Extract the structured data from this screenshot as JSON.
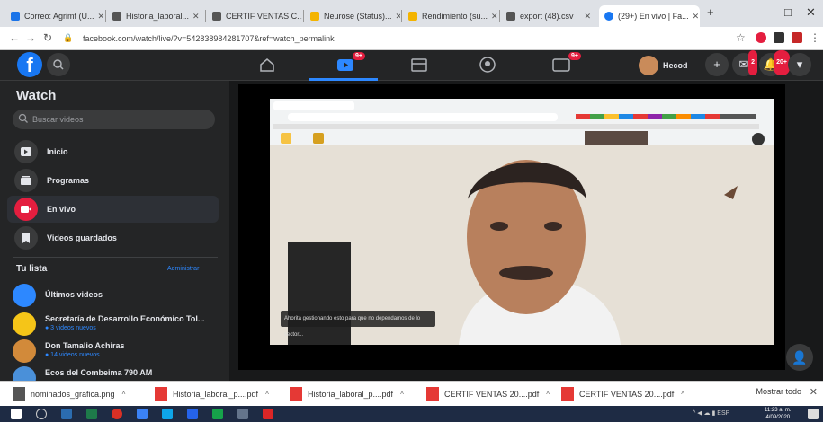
{
  "browser": {
    "tabs": [
      {
        "label": "Correo: Agrimf (U...",
        "color": "#1a73e8"
      },
      {
        "label": "Historia_laboral...",
        "color": "#555555"
      },
      {
        "label": "CERTIF VENTAS C...",
        "color": "#555555"
      },
      {
        "label": "Neurose (Status)...",
        "color": "#f4b400"
      },
      {
        "label": "Rendimiento (su...",
        "color": "#f4b400"
      },
      {
        "label": "export (48).csv",
        "color": "#555555"
      },
      {
        "label": "(29+) En vivo | Fa...",
        "color": "#1877f2"
      }
    ],
    "url": "facebook.com/watch/live/?v=542838984281707&ref=watch_permalink"
  },
  "fb": {
    "profile_name": "Hecod",
    "badges": {
      "watch": "9+",
      "gaming": "9+",
      "messenger": "2",
      "notifications": "20+"
    }
  },
  "sidebar": {
    "title": "Watch",
    "search_placeholder": "Buscar videos",
    "nav": [
      {
        "label": "Inicio"
      },
      {
        "label": "Programas"
      },
      {
        "label": "En vivo"
      },
      {
        "label": "Videos guardados"
      }
    ],
    "list_title": "Tu lista",
    "list_action": "Administrar",
    "list": [
      {
        "name": "Últimos videos",
        "sub": "",
        "color": "#2d88ff"
      },
      {
        "name": "Secretaría de Desarrollo Económico Tol...",
        "sub": "● 3 videos nuevos",
        "color": "#f5c518"
      },
      {
        "name": "Don Tamalio Achiras",
        "sub": "● 14 videos nuevos",
        "color": "#d28a3a"
      },
      {
        "name": "Ecos del Combeima 790 AM",
        "sub": "",
        "color": "#4a90d9"
      }
    ]
  },
  "video": {
    "caption": "Ahorita gestionando esto para que no dependamos de lo sector..."
  },
  "downloads": [
    {
      "name": "nominados_grafica.png"
    },
    {
      "name": "Historia_laboral_p....pdf"
    },
    {
      "name": "Historia_laboral_p....pdf"
    },
    {
      "name": "CERTIF VENTAS 20....pdf"
    },
    {
      "name": "CERTIF VENTAS 20....pdf"
    }
  ],
  "downloads_show_all": "Mostrar todo",
  "taskbar": {
    "time": "11:23 a. m.",
    "date": "4/09/2020"
  }
}
